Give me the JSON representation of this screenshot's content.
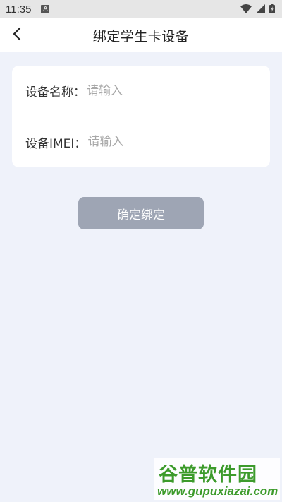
{
  "status_bar": {
    "time": "11:35",
    "notification_icon": "a-notification-icon",
    "icons": [
      "wifi-icon",
      "signal-icon",
      "battery-icon"
    ]
  },
  "nav": {
    "back_icon": "chevron-left-icon",
    "title": "绑定学生卡设备"
  },
  "form": {
    "device_name": {
      "label": "设备名称：",
      "placeholder": "请输入",
      "value": ""
    },
    "device_imei": {
      "label": "设备IMEI：",
      "placeholder": "请输入",
      "value": ""
    }
  },
  "confirm_button": {
    "label": "确定绑定",
    "color": "#9ea5b4"
  },
  "watermark": {
    "title": "谷普软件园",
    "url": "www.gupuxiazai.com"
  },
  "colors": {
    "page_background": "#eff2fa",
    "watermark_green": "#3d9b2c"
  }
}
